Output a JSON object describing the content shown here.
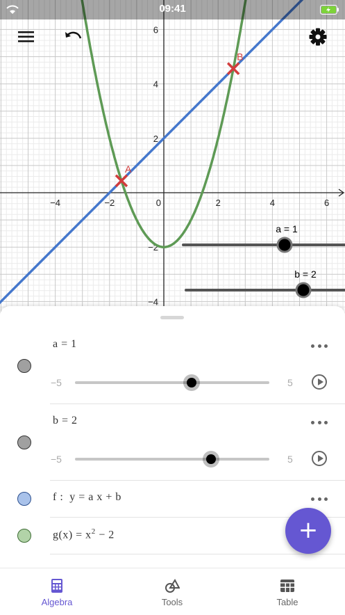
{
  "status": {
    "time": "09:41"
  },
  "toolbar": {
    "menu_icon": "menu-icon",
    "undo_icon": "undo-icon",
    "settings_icon": "gear-icon"
  },
  "graph": {
    "x_ticks": [
      "−4",
      "−2",
      "2",
      "4",
      "6"
    ],
    "y_ticks": [
      "6",
      "4",
      "2",
      "−2",
      "−4"
    ],
    "zero_label": "0",
    "point_a_label": "A",
    "point_b_label": "B",
    "slider_a_caption": "a = 1",
    "slider_b_caption": "b = 2",
    "line_color": "#4477cc",
    "parabola_color": "#5e9a55",
    "point_color": "#d23c3c",
    "a_value": 1,
    "b_value": 2
  },
  "algebra": {
    "rows": [
      {
        "expr": "a = 1",
        "min": "−5",
        "max": "5",
        "value": 1,
        "marble_color": "#a0a0a0"
      },
      {
        "expr": "b = 2",
        "min": "−5",
        "max": "5",
        "value": 2,
        "marble_color": "#a0a0a0"
      },
      {
        "expr_prefix": "f :  y = a x + b",
        "marble_color": "#a9c2ea"
      },
      {
        "expr_prefix": "g(x) = x",
        "sup": "2",
        "expr_suffix": " − 2",
        "marble_color": "#b2d3a8"
      }
    ],
    "add_label": "+"
  },
  "tabs": [
    {
      "label": "Algebra",
      "icon": "calculator-icon",
      "active": true
    },
    {
      "label": "Tools",
      "icon": "tools-icon",
      "active": false
    },
    {
      "label": "Table",
      "icon": "table-icon",
      "active": false
    }
  ],
  "colors": {
    "accent": "#6557d2",
    "inactive": "#666666"
  }
}
